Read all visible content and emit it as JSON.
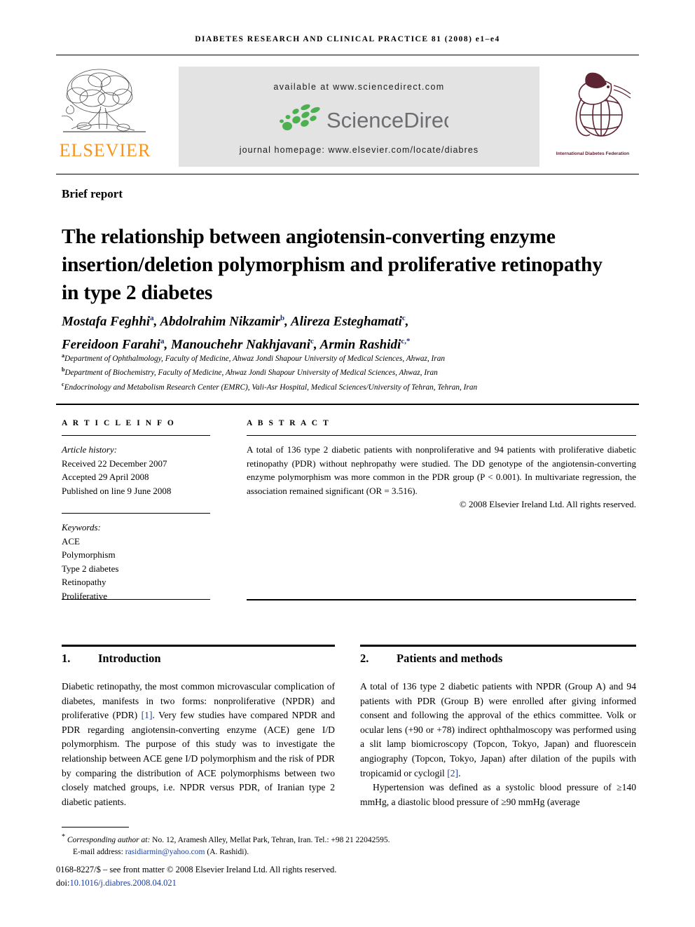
{
  "running_head": "DIABETES RESEARCH AND CLINICAL PRACTICE 81 (2008) e1–e4",
  "masthead": {
    "publisher_name": "ELSEVIER",
    "available_at": "available at www.sciencedirect.com",
    "sciencedirect_wordmark": "ScienceDirect",
    "journal_homepage": "journal homepage: www.elsevier.com/locate/diabres",
    "society_logo_caption": "International Diabetes Federation",
    "colors": {
      "elsevier_orange": "#F7941E",
      "banner_gray": "#e3e3e3",
      "sciencedirect_green": "#4CAF50",
      "sciencedirect_text_gray": "#6d6e71",
      "idf_maroon": "#5d2533"
    }
  },
  "article": {
    "type_label": "Brief report",
    "title": "The relationship between angiotensin-converting enzyme insertion/deletion polymorphism and proliferative retinopathy in type 2 diabetes",
    "authors_line_1_part_1": "Mostafa Feghhi",
    "authors_line_1_sup_1": "a",
    "authors_line_1_part_2": ", Abdolrahim Nikzamir",
    "authors_line_1_sup_2": "b",
    "authors_line_1_part_3": ", Alireza Esteghamati",
    "authors_line_1_sup_3": "c",
    "authors_line_1_part_4": ",",
    "authors_line_2_part_1": "Fereidoon Farahi",
    "authors_line_2_sup_1": "a",
    "authors_line_2_part_2": ", Manouchehr Nakhjavani",
    "authors_line_2_sup_2": "c",
    "authors_line_2_part_3": ", Armin Rashidi",
    "authors_line_2_sup_3": "c,*",
    "affiliations": [
      {
        "marker": "a",
        "text": "Department of Ophthalmology, Faculty of Medicine, Ahwaz Jondi Shapour University of Medical Sciences, Ahwaz, Iran"
      },
      {
        "marker": "b",
        "text": "Department of Biochemistry, Faculty of Medicine, Ahwaz Jondi Shapour University of Medical Sciences, Ahwaz, Iran"
      },
      {
        "marker": "c",
        "text": "Endocrinology and Metabolism Research Center (EMRC), Vali-Asr Hospital, Medical Sciences/University of Tehran, Tehran, Iran"
      }
    ]
  },
  "article_info": {
    "heading": "A R T I C L E   I N F O",
    "history_label": "Article history:",
    "received": "Received 22 December 2007",
    "accepted": "Accepted 29 April 2008",
    "published": "Published on line 9 June 2008",
    "keywords_label": "Keywords:",
    "keywords": [
      "ACE",
      "Polymorphism",
      "Type 2 diabetes",
      "Retinopathy",
      "Proliferative"
    ]
  },
  "abstract": {
    "heading": "A B S T R A C T",
    "body": "A total of 136 type 2 diabetic patients with nonproliferative and 94 patients with proliferative diabetic retinopathy (PDR) without nephropathy were studied. The DD genotype of the angiotensin-converting enzyme polymorphism was more common in the PDR group (P < 0.001). In multivariate regression, the association remained significant (OR = 3.516).",
    "copyright": "© 2008 Elsevier Ireland Ltd. All rights reserved."
  },
  "sections": {
    "introduction": {
      "number": "1.",
      "title": "Introduction",
      "para_1_part_1": "Diabetic retinopathy, the most common microvascular complication of diabetes, manifests in two forms: nonproliferative (NPDR) and proliferative (PDR) ",
      "para_1_ref": "[1]",
      "para_1_part_2": ". Very few studies have compared NPDR and PDR regarding angiotensin-converting enzyme (ACE) gene I/D polymorphism. The purpose of this study was to investigate the relationship between ACE gene I/D polymorphism and the risk of PDR by comparing the distribution of ACE polymorphisms between two closely matched groups, i.e. NPDR versus PDR, of Iranian type 2 diabetic patients."
    },
    "patients_and_methods": {
      "number": "2.",
      "title": "Patients and methods",
      "para_1_part_1": "A total of 136 type 2 diabetic patients with NPDR (Group A) and 94 patients with PDR (Group B) were enrolled after giving informed consent and following the approval of the ethics committee. Volk or ocular lens (+90 or +78) indirect ophthalmoscopy was performed using a slit lamp biomicroscopy (Topcon, Tokyo, Japan) and fluorescein angiography (Topcon, Tokyo, Japan) after dilation of the pupils with tropicamid or cyclogil ",
      "para_1_ref": "[2]",
      "para_1_part_2": ".",
      "para_2": "Hypertension was defined as a systolic blood pressure of ≥140 mmHg, a diastolic blood pressure of ≥90 mmHg (average"
    }
  },
  "footer": {
    "corresponding_marker": "*",
    "corresponding_label": "Corresponding author at:",
    "corresponding_address": " No. 12, Aramesh Alley, Mellat Park, Tehran, Iran. Tel.: +98 21 22042595.",
    "email_label": "E-mail address:",
    "email": "rasidiarmin@yahoo.com",
    "email_attribution": " (A. Rashidi).",
    "imprint": "0168-8227/$ – see front matter © 2008 Elsevier Ireland Ltd. All rights reserved.",
    "doi_label": "doi:",
    "doi": "10.1016/j.diabres.2008.04.021"
  }
}
